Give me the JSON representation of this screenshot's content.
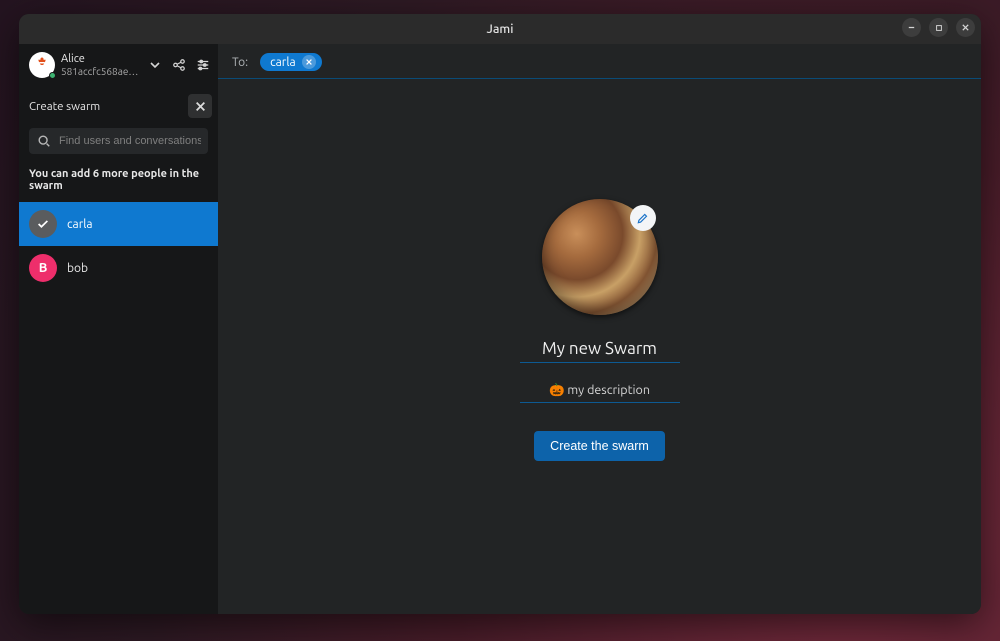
{
  "window": {
    "title": "Jami"
  },
  "account": {
    "username": "Alice",
    "hash": "581accfc568aeb…"
  },
  "sidebar": {
    "create_label": "Create swarm",
    "search_placeholder": "Find users and conversations",
    "helper": "You can add 6 more people in the swarm",
    "contacts": [
      {
        "name": "carla",
        "selected": true,
        "initial": "✓",
        "avatar_style": "check"
      },
      {
        "name": "bob",
        "selected": false,
        "initial": "B",
        "avatar_style": "pink"
      }
    ]
  },
  "compose": {
    "to_label": "To:",
    "chips": [
      {
        "name": "carla"
      }
    ]
  },
  "swarm": {
    "name": "My new Swarm",
    "description": "🎃 my description",
    "create_button": "Create the swarm"
  }
}
